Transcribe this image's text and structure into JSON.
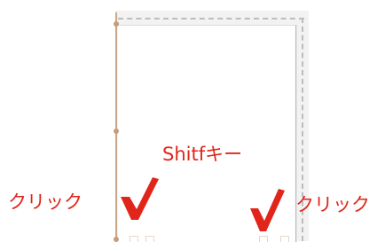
{
  "annotations": {
    "shift_key": "Shitfキー",
    "click_left": "クリック",
    "click_right": "クリック"
  },
  "colors": {
    "annotation": "#e1251b",
    "handle": "#c89c78",
    "page_border": "#b8b8b8",
    "guide": "#bcbcbc",
    "background": "#f2f2f2"
  },
  "icons": {
    "left_mark": "checkmark-icon",
    "right_mark": "checkmark-icon"
  }
}
